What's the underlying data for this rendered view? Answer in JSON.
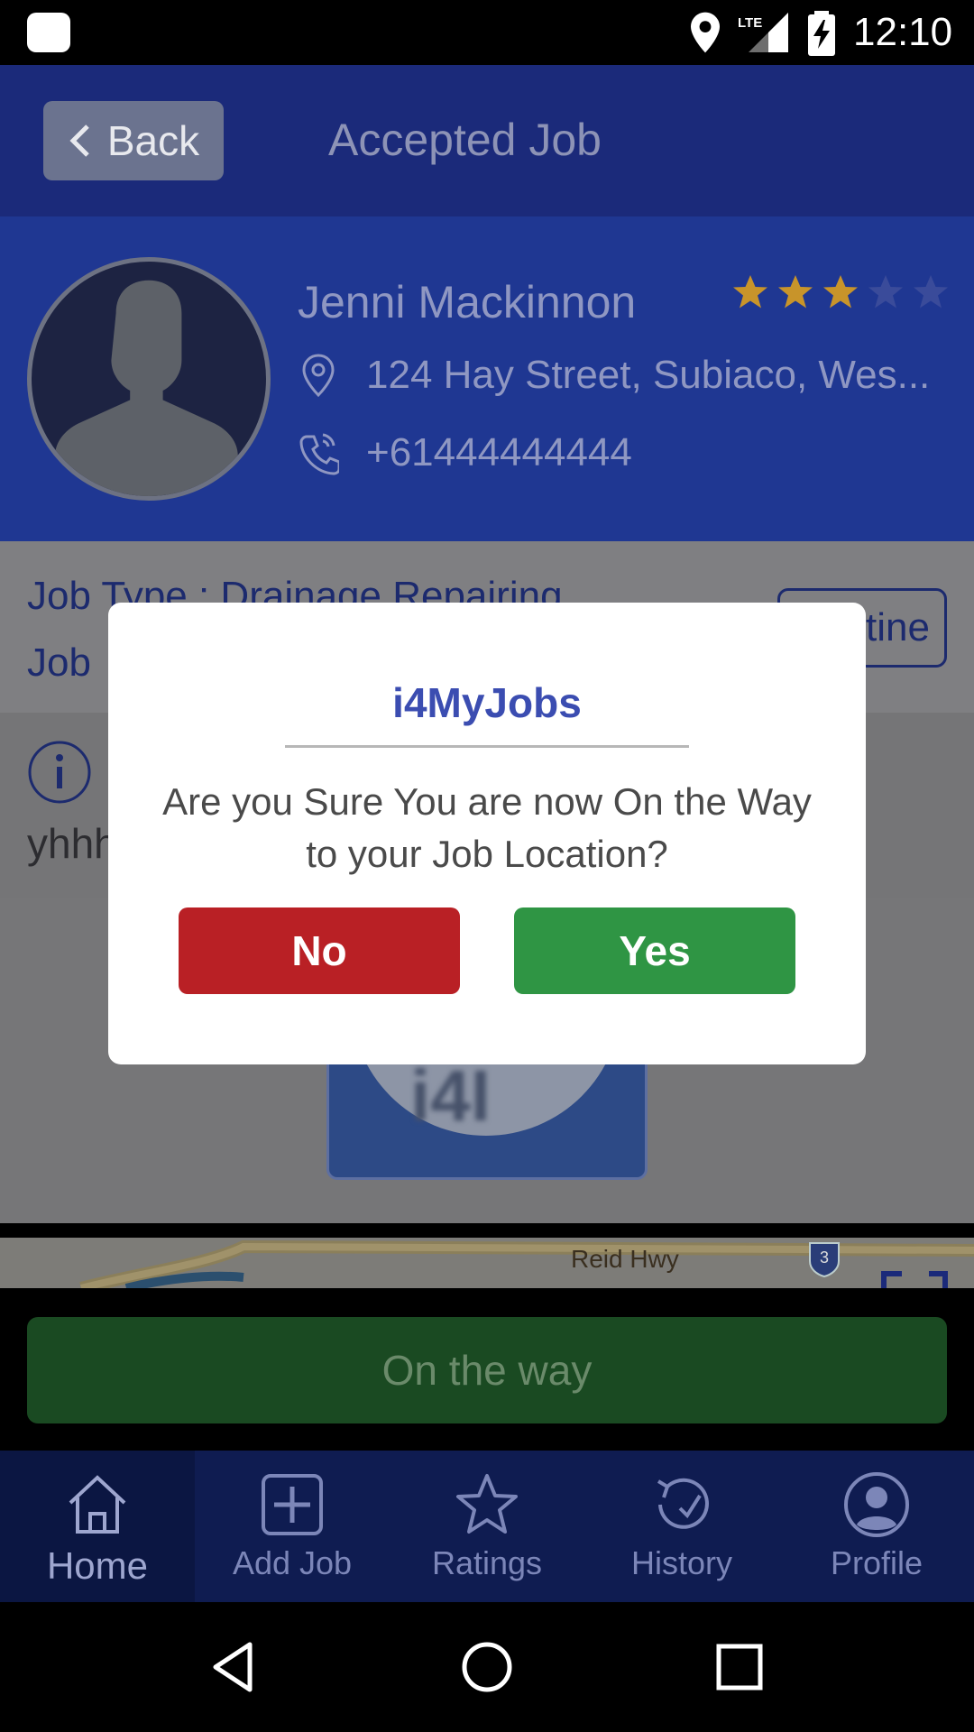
{
  "status_bar": {
    "time": "12:10",
    "network": "LTE"
  },
  "app_bar": {
    "back_label": "Back",
    "title": "Accepted Job"
  },
  "customer": {
    "name": "Jenni Mackinnon",
    "rating": 3,
    "rating_max": 5,
    "address": "124 Hay Street, Subiaco, Wes...",
    "phone": "+61444444444"
  },
  "job": {
    "type_line": "Job Type : Drainage Repairing",
    "second_line": "Job",
    "routine_label": "tine"
  },
  "notes": {
    "text": "yhhh"
  },
  "map": {
    "road_label": "Reid Hwy",
    "shield_number": "3"
  },
  "logo": {
    "text": "i4I"
  },
  "on_way_label": "On the way",
  "nav": {
    "items": [
      {
        "label": "Home",
        "icon": "home-icon"
      },
      {
        "label": "Add Job",
        "icon": "add-job-icon"
      },
      {
        "label": "Ratings",
        "icon": "star-icon"
      },
      {
        "label": "History",
        "icon": "history-icon"
      },
      {
        "label": "Profile",
        "icon": "profile-icon"
      }
    ]
  },
  "dialog": {
    "title": "i4MyJobs",
    "message": "Are you Sure You are now On the Way to your Job Location?",
    "no_label": "No",
    "yes_label": "Yes"
  },
  "colors": {
    "app_bar": "#1b2a7a",
    "profile_panel": "#1f3792",
    "dialog_title": "#3b4db1",
    "no_button": "#b92025",
    "yes_button": "#2f9544",
    "star_filled": "#c8942a"
  }
}
